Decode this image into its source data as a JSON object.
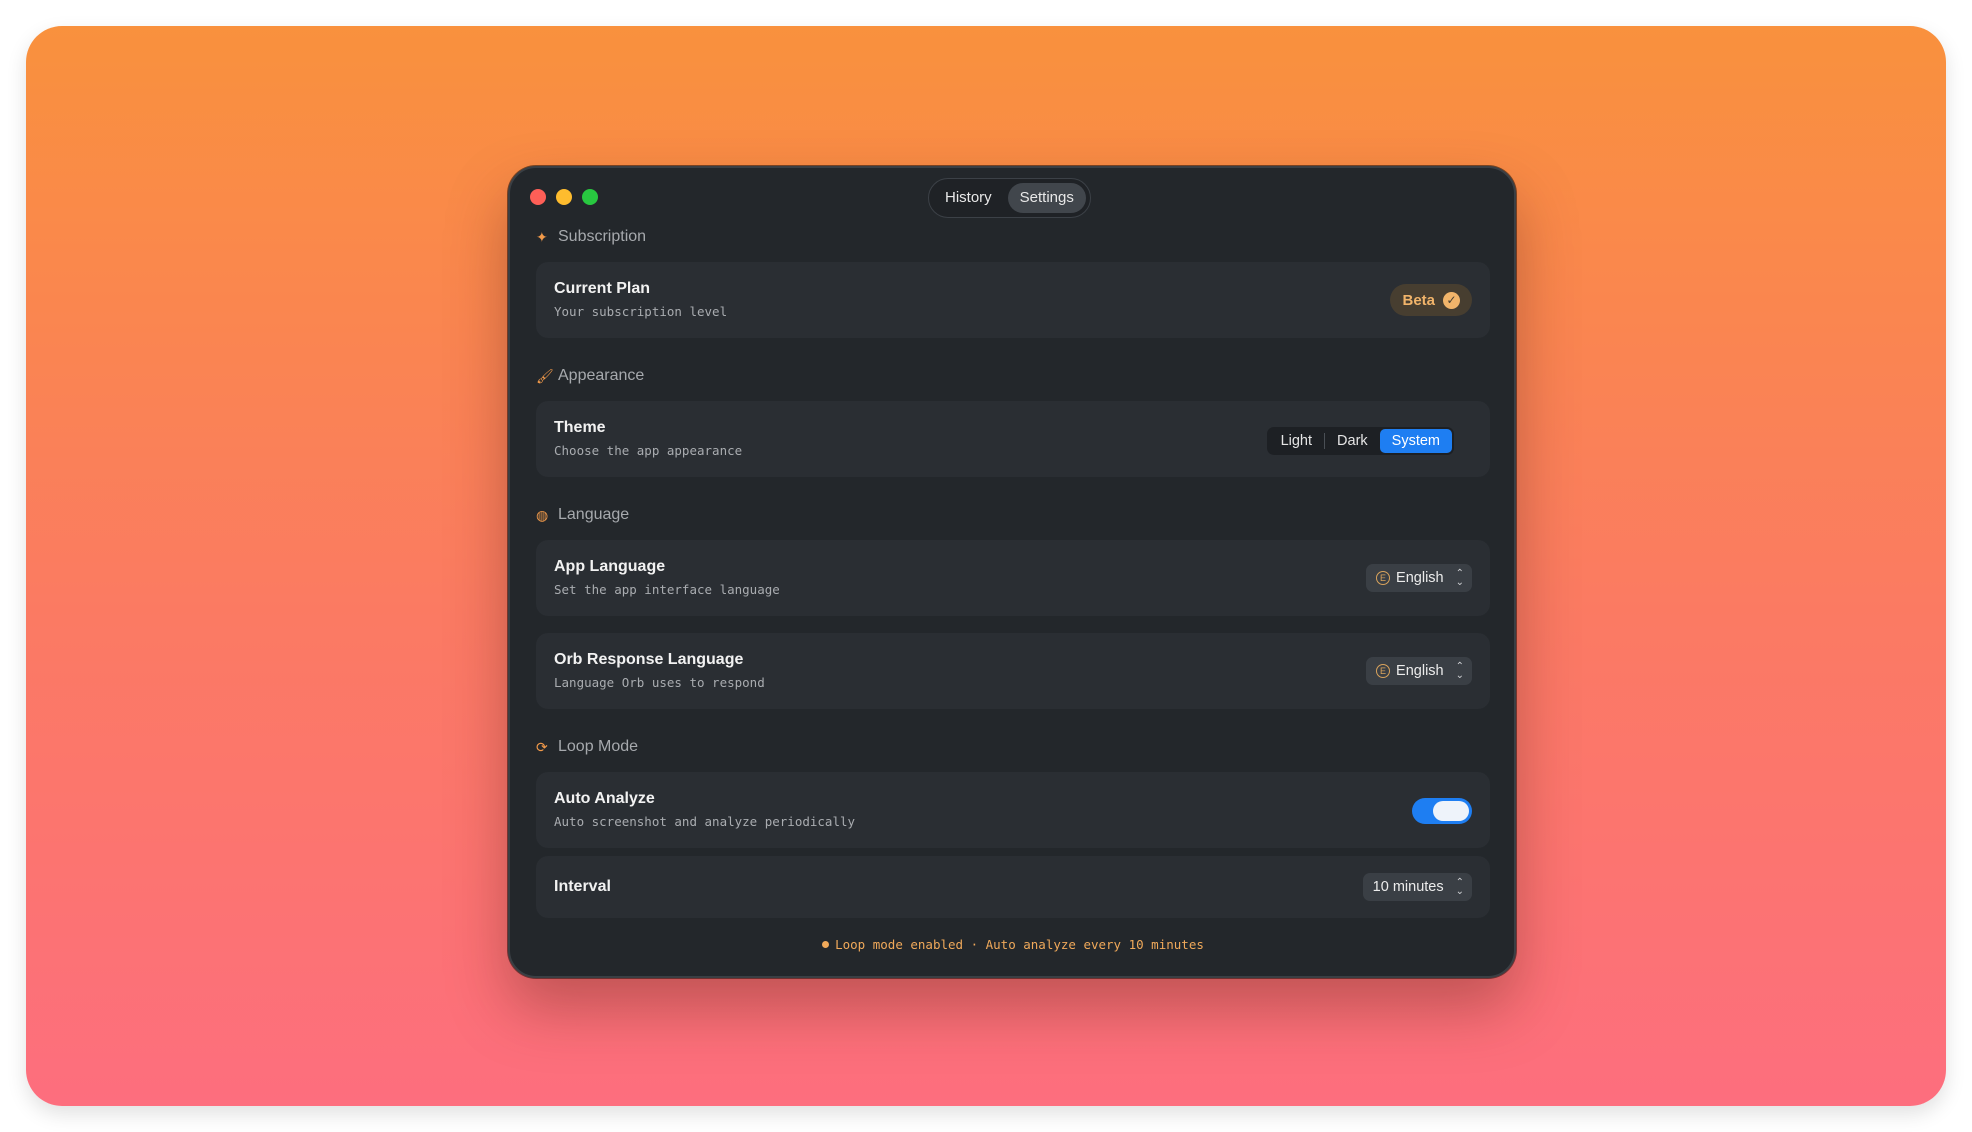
{
  "nav": {
    "tabs": [
      {
        "label": "History",
        "active": false
      },
      {
        "label": "Settings",
        "active": true
      }
    ]
  },
  "sections": {
    "subscription": {
      "header": "Subscription",
      "icon": "sparkle-icon",
      "current_plan": {
        "title": "Current Plan",
        "subtitle": "Your subscription level",
        "badge": "Beta"
      }
    },
    "appearance": {
      "header": "Appearance",
      "icon": "paintbrush-icon",
      "theme": {
        "title": "Theme",
        "subtitle": "Choose the app appearance",
        "options": [
          "Light",
          "Dark",
          "System"
        ],
        "selected": "System"
      }
    },
    "language": {
      "header": "Language",
      "icon": "globe-icon",
      "app_language": {
        "title": "App Language",
        "subtitle": "Set the app interface language",
        "value": "English"
      },
      "orb_language": {
        "title": "Orb Response Language",
        "subtitle": "Language Orb uses to respond",
        "value": "English"
      }
    },
    "loop_mode": {
      "header": "Loop Mode",
      "icon": "refresh-icon",
      "auto_analyze": {
        "title": "Auto Analyze",
        "subtitle": "Auto screenshot and analyze periodically",
        "enabled": true
      },
      "interval": {
        "title": "Interval",
        "value": "10 minutes"
      },
      "status_note": "Loop mode enabled · Auto analyze every 10 minutes"
    }
  },
  "colors": {
    "accent": "#1e7ef2",
    "warning": "#f0a95a",
    "window_bg": "#23272b",
    "card_bg": "#2a2e33"
  }
}
